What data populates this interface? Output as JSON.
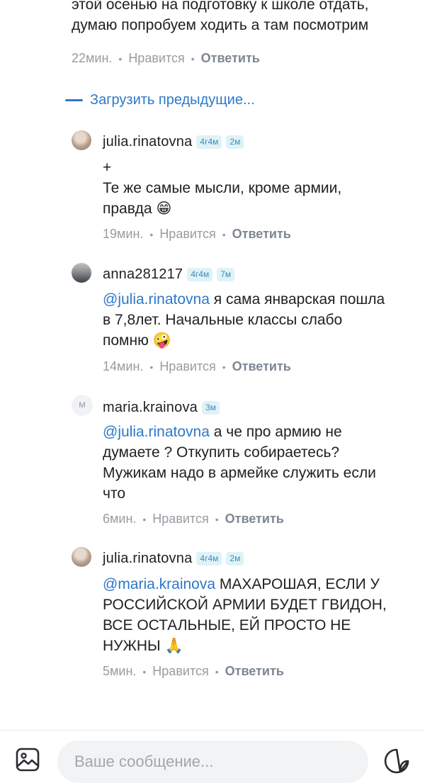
{
  "previous_comment": {
    "lines": [
      "этой осенью на подготовку к школе отдать,",
      "думаю попробуем ходить а там посмотрим"
    ],
    "time": "22мин.",
    "like_label": "Нравится",
    "reply_label": "Ответить"
  },
  "load_previous_label": "Загрузить предыдущие...",
  "comments": [
    {
      "username": "julia.rinatovna",
      "badges": [
        "4г4м",
        "2м"
      ],
      "lines": [
        "+",
        "Те же самые мысли, кроме армии,",
        "правда"
      ],
      "emoji": "😁",
      "time": "19мин.",
      "like_label": "Нравится",
      "reply_label": "Ответить"
    },
    {
      "username": "anna281217",
      "badges": [
        "4г4м",
        "7м"
      ],
      "mention": "@julia.rinatovna",
      "lines": [
        " я сама январская пошла",
        "в 7,8лет. Начальные классы слабо",
        "помню"
      ],
      "emoji": "🤪",
      "time": "14мин.",
      "like_label": "Нравится",
      "reply_label": "Ответить"
    },
    {
      "username": "maria.krainova",
      "avatar_letter": "М",
      "badges": [
        "3м"
      ],
      "mention": "@julia.rinatovna",
      "lines": [
        " а че про армию не",
        "думаете ? Откупить собираетесь?",
        "Мужикам надо в армейке служить если",
        "что"
      ],
      "time": "6мин.",
      "like_label": "Нравится",
      "reply_label": "Ответить"
    },
    {
      "username": "julia.rinatovna",
      "badges": [
        "4г4м",
        "2м"
      ],
      "mention": "@maria.krainova",
      "lines": [
        " МАХАРОШАЯ, ЕСЛИ У",
        "РОССИЙСКОЙ АРМИИ БУДЕТ ГВИДОН,",
        "ВСЕ ОСТАЛЬНЫЕ, ЕЙ ПРОСТО НЕ",
        "НУЖНЫ"
      ],
      "emoji": "🙏",
      "time": "5мин.",
      "like_label": "Нравится",
      "reply_label": "Ответить"
    }
  ],
  "composer": {
    "placeholder": "Ваше сообщение...",
    "attach_icon": "image-icon",
    "sticker_icon": "sticker-icon"
  },
  "colors": {
    "link": "#2e78c7",
    "meta": "#9a9aa2",
    "badge_bg": "#dff2f7",
    "badge_text": "#3a8ab8"
  }
}
